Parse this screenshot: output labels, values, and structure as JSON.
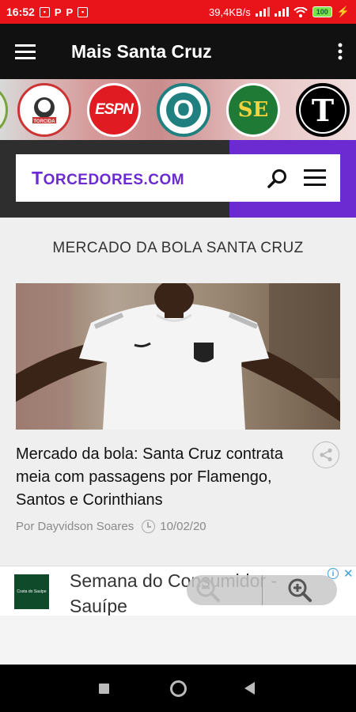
{
  "status_bar": {
    "time": "16:52",
    "notif_icons": [
      "P",
      "P"
    ],
    "net_speed": "39,4KB/s",
    "battery": "100"
  },
  "app_bar": {
    "title": "Mais Santa Cruz"
  },
  "logo_strip": {
    "logos": [
      "ESPN",
      "O",
      "SE",
      "T"
    ],
    "torcida_label": "TORCIDA"
  },
  "site_header": {
    "logo_first": "T",
    "logo_rest": "ORCEDORES.COM"
  },
  "content": {
    "section_title": "MERCADO DA BOLA SANTA CRUZ",
    "article": {
      "title": "Mercado da bola: Santa Cruz contrata meia com passagens por Flamengo, Santos e Corinthians",
      "author": "Por Dayvidson Soares",
      "date": "10/02/20"
    }
  },
  "ad": {
    "text": "Semana do Consumidor - Sauípe",
    "logo_text": "Costa do Sauípe"
  },
  "colors": {
    "status_bar": "#e8141a",
    "app_bar": "#111111",
    "brand_purple": "#6b2bd1"
  }
}
